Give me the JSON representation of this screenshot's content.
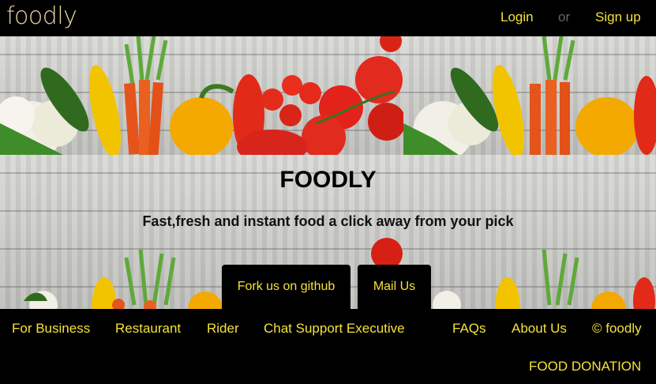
{
  "brand": {
    "logo": "foodly"
  },
  "auth": {
    "login": "Login",
    "or": "or",
    "signup": "Sign up"
  },
  "hero": {
    "title": "FOODLY",
    "subtitle": "Fast,fresh and instant food a click away from your pick",
    "buttons": {
      "github": "Fork us on github",
      "mail": "Mail Us"
    }
  },
  "footer": {
    "left": [
      "For Business",
      "Restaurant",
      "Rider",
      "Chat Support Executive"
    ],
    "right": [
      "FAQs",
      "About Us",
      "© foodly"
    ],
    "donation": "FOOD DONATION"
  },
  "colors": {
    "accent": "#f4e23a",
    "background": "#000000",
    "logo": "#e8d6a0"
  }
}
